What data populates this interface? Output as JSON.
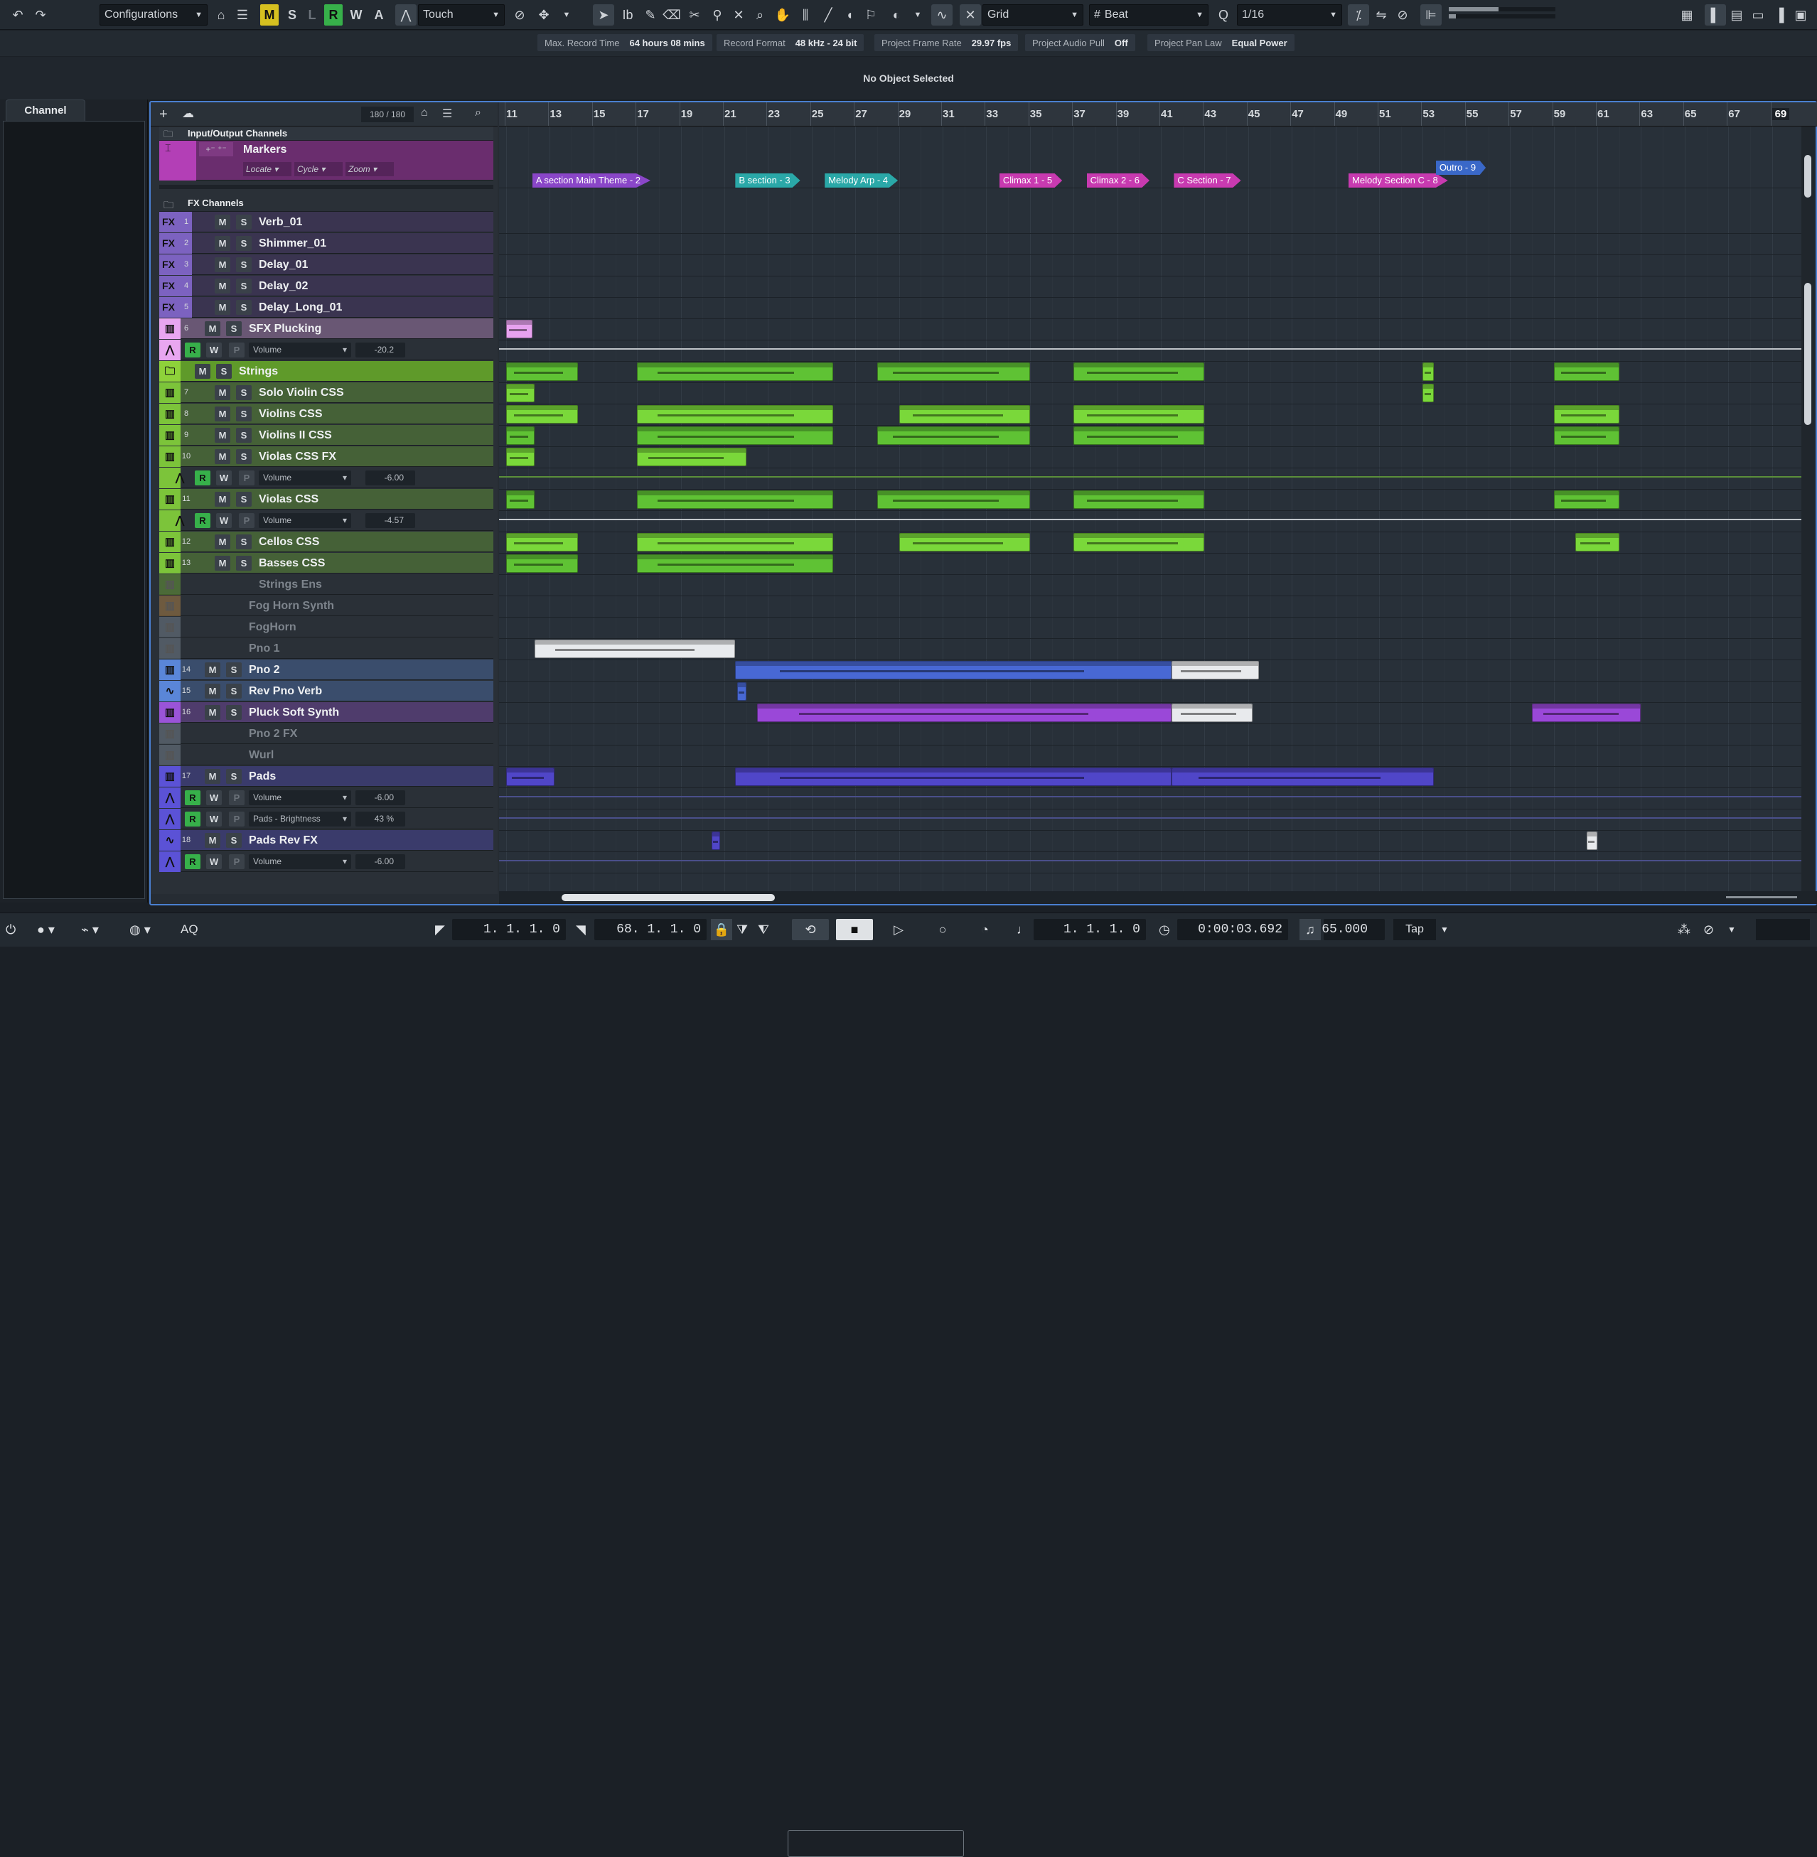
{
  "toolbar": {
    "configurations": "Configurations",
    "mode_letters": [
      "M",
      "S",
      "L",
      "R",
      "W",
      "A"
    ],
    "automation_mode": "Touch",
    "snap_type": "Grid",
    "grid_type": "Beat",
    "quantize": "1/16"
  },
  "info_line": [
    {
      "label": "Max. Record Time",
      "value": "64 hours 08 mins"
    },
    {
      "label": "Record Format",
      "value": "48 kHz - 24 bit"
    },
    {
      "label": "Project Frame Rate",
      "value": "29.97 fps"
    },
    {
      "label": "Project Audio Pull",
      "value": "Off"
    },
    {
      "label": "Project Pan Law",
      "value": "Equal Power"
    }
  ],
  "status": "No Object Selected",
  "left_zone": {
    "tab": "Channel"
  },
  "track_list_header": {
    "count": "180 / 180"
  },
  "io_folder": "Input/Output Channels",
  "markers": {
    "name": "Markers",
    "locate": "Locate",
    "cycle": "Cycle",
    "zoom": "Zoom"
  },
  "fx_folder": "FX Channels",
  "tracks": [
    {
      "kind": "fx",
      "num": "1",
      "name": "Verb_01"
    },
    {
      "kind": "fx",
      "num": "2",
      "name": "Shimmer_01"
    },
    {
      "kind": "fx",
      "num": "3",
      "name": "Delay_01"
    },
    {
      "kind": "fx",
      "num": "4",
      "name": "Delay_02"
    },
    {
      "kind": "fx",
      "num": "5",
      "name": "Delay_Long_01"
    },
    {
      "kind": "inst",
      "num": "6",
      "name": "SFX Plucking",
      "color": "#e8a6f0"
    },
    {
      "kind": "auto",
      "param": "Volume",
      "value": "-20.2",
      "color": "#e8a6f0"
    },
    {
      "kind": "folder",
      "name": "Strings",
      "color": "#8ed23a"
    },
    {
      "kind": "inst",
      "num": "7",
      "name": "Solo Violin CSS",
      "color": "#7cc43a"
    },
    {
      "kind": "inst",
      "num": "8",
      "name": "Violins CSS",
      "color": "#7cc43a"
    },
    {
      "kind": "inst",
      "num": "9",
      "name": "Violins II CSS",
      "color": "#7cc43a"
    },
    {
      "kind": "inst",
      "num": "10",
      "name": "Violas CSS FX",
      "color": "#7cc43a"
    },
    {
      "kind": "auto",
      "param": "Volume",
      "value": "-6.00",
      "color": "#7cc43a"
    },
    {
      "kind": "inst",
      "num": "11",
      "name": "Violas CSS",
      "color": "#7cc43a"
    },
    {
      "kind": "auto",
      "param": "Volume",
      "value": "-4.57",
      "color": "#7cc43a"
    },
    {
      "kind": "inst",
      "num": "12",
      "name": "Cellos CSS",
      "color": "#7cc43a"
    },
    {
      "kind": "inst",
      "num": "13",
      "name": "Basses CSS",
      "color": "#7cc43a"
    },
    {
      "kind": "disabled",
      "name": "Strings Ens",
      "color": "#7cc43a",
      "indent": true
    },
    {
      "kind": "disabled",
      "name": "Fog Horn Synth",
      "color": "#d59a4a"
    },
    {
      "kind": "disabled",
      "name": "FogHorn",
      "color": "#8c9aa8"
    },
    {
      "kind": "disabled",
      "name": "Pno 1",
      "color": "#8c9aa8"
    },
    {
      "kind": "inst",
      "num": "14",
      "name": "Pno 2",
      "color": "#5a86d8"
    },
    {
      "kind": "audio",
      "num": "15",
      "name": "Rev Pno Verb",
      "color": "#5a86d8"
    },
    {
      "kind": "inst",
      "num": "16",
      "name": "Pluck Soft Synth",
      "color": "#9a54d8"
    },
    {
      "kind": "disabled",
      "name": "Pno 2 FX",
      "color": "#8c9aa8"
    },
    {
      "kind": "disabled",
      "name": "Wurl",
      "color": "#8c9aa8"
    },
    {
      "kind": "inst",
      "num": "17",
      "name": "Pads",
      "color": "#5b52d6"
    },
    {
      "kind": "auto",
      "param": "Volume",
      "value": "-6.00",
      "color": "#5b52d6"
    },
    {
      "kind": "auto",
      "param": "Pads - Brightness",
      "value": "43 %",
      "color": "#5b52d6"
    },
    {
      "kind": "audio",
      "num": "18",
      "name": "Pads Rev FX",
      "color": "#5b52d6"
    },
    {
      "kind": "auto",
      "param": "Volume",
      "value": "-6.00",
      "color": "#5b52d6"
    }
  ],
  "ruler": [
    "11",
    "13",
    "15",
    "17",
    "19",
    "21",
    "23",
    "25",
    "27",
    "29",
    "31",
    "33",
    "35",
    "37",
    "39",
    "41",
    "43",
    "45",
    "47",
    "49",
    "51",
    "53",
    "55",
    "57",
    "59",
    "61",
    "63",
    "65",
    "67",
    "69"
  ],
  "marker_events": [
    {
      "label": "A section Main Theme - 2",
      "color": "#8a46c8",
      "bar": 12.2,
      "row": 1
    },
    {
      "label": "B section - 3",
      "color": "#2aa8a8",
      "bar": 21.5,
      "row": 1
    },
    {
      "label": "Melody Arp - 4",
      "color": "#2aa8a8",
      "bar": 25.6,
      "row": 1
    },
    {
      "label": "Climax 1 - 5",
      "color": "#c83ab0",
      "bar": 33.6,
      "row": 1
    },
    {
      "label": "Climax 2 - 6",
      "color": "#c83ab0",
      "bar": 37.6,
      "row": 1
    },
    {
      "label": "C Section - 7",
      "color": "#c83ab0",
      "bar": 41.6,
      "row": 1
    },
    {
      "label": "Melody Section C - 8",
      "color": "#c83ab0",
      "bar": 49.6,
      "row": 1
    },
    {
      "label": "Outro - 9",
      "color": "#3a68c8",
      "bar": 53.6,
      "row": 0
    }
  ],
  "transport": {
    "left_locator": "1. 1. 1.   0",
    "right_locator": "68. 1. 1.   0",
    "position": "1. 1. 1.   0",
    "time": "0:00:03.692",
    "tempo": "65.000",
    "tap": "Tap",
    "aq": "AQ"
  },
  "colors": {
    "accent": "#4a7fd0",
    "strings": "#7cc43a",
    "piano": "#5a86d8",
    "pluck": "#9a54d8",
    "pads": "#5b52d6"
  }
}
